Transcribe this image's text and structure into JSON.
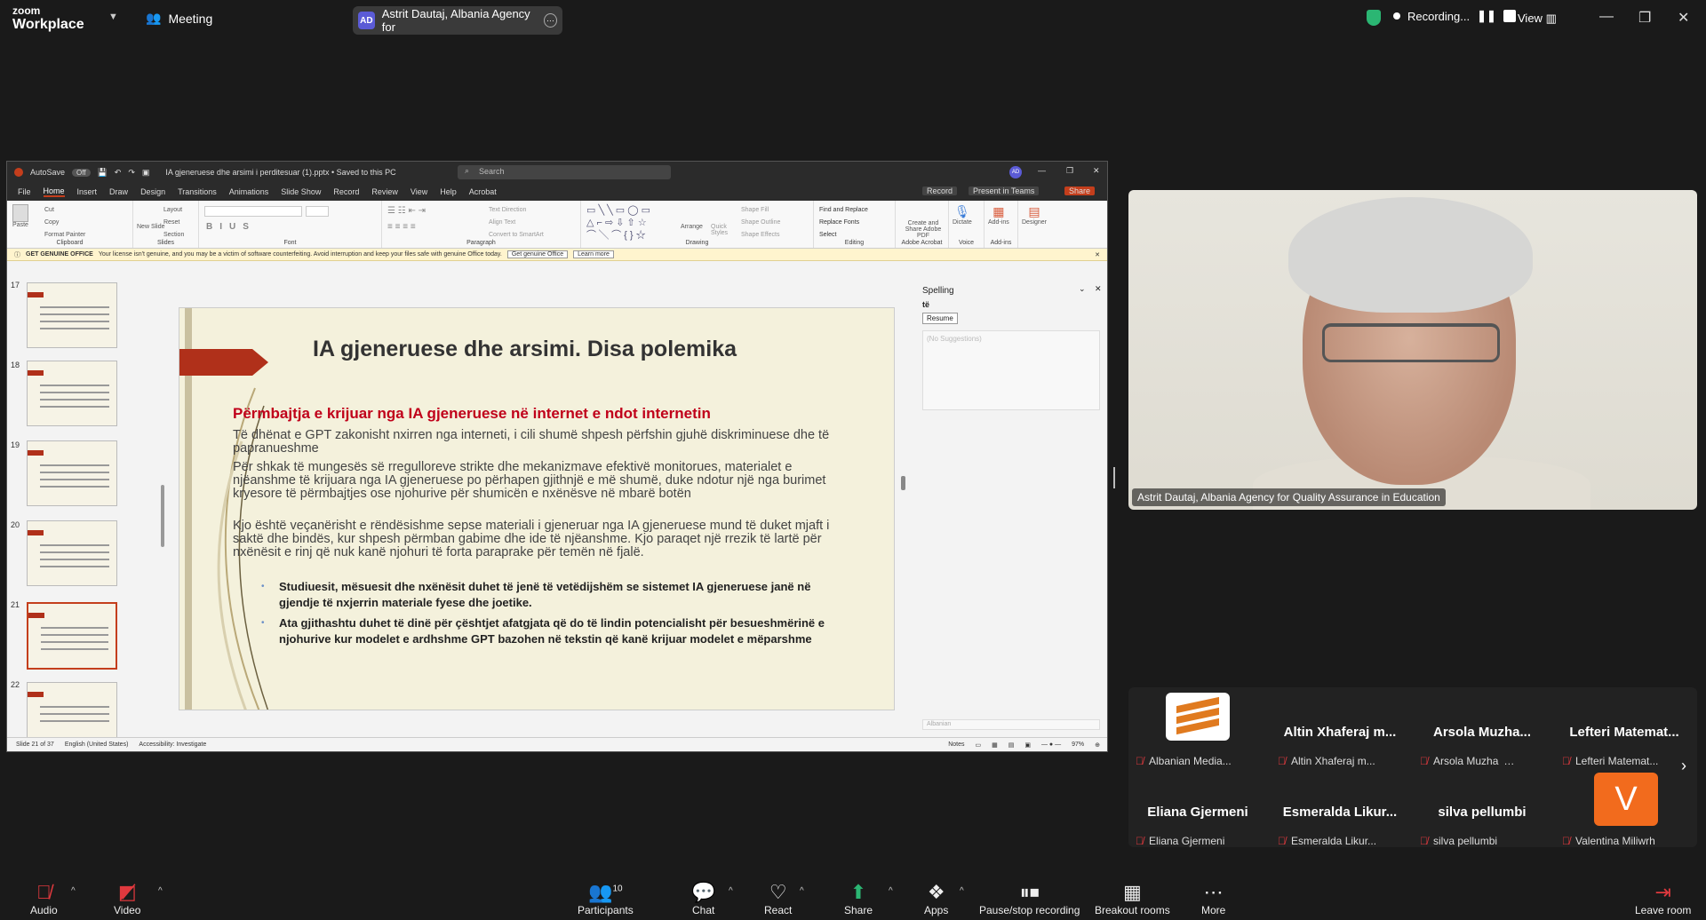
{
  "zoom": {
    "logo_top": "zoom",
    "logo_bottom": "Workplace",
    "meeting_label": "Meeting",
    "active_speaker": "Astrit Dautaj, Albania Agency for",
    "active_speaker_initials": "AD",
    "recording_label": "Recording...",
    "view_label": "View"
  },
  "ppt": {
    "autosave": "AutoSave",
    "autosave_state": "Off",
    "filename": "IA gjeneruese dhe arsimi i perditesuar (1).pptx • Saved to this PC",
    "search_placeholder": "Search",
    "user_initials": "AD",
    "menus": [
      "File",
      "Home",
      "Insert",
      "Draw",
      "Design",
      "Transitions",
      "Animations",
      "Slide Show",
      "Record",
      "Review",
      "View",
      "Help",
      "Acrobat"
    ],
    "record_btn": "Record",
    "present_teams": "Present in Teams",
    "share_btn": "Share",
    "ribbon": {
      "paste": "Paste",
      "cut": "Cut",
      "copy": "Copy",
      "format_painter": "Format Painter",
      "clipboard": "Clipboard",
      "new_slide": "New Slide",
      "layout": "Layout",
      "reset": "Reset",
      "section": "Section",
      "slides": "Slides",
      "font": "Font",
      "paragraph": "Paragraph",
      "text_direction": "Text Direction",
      "align_text": "Align Text",
      "convert_smartart": "Convert to SmartArt",
      "drawing": "Drawing",
      "arrange": "Arrange",
      "quick_styles": "Quick Styles",
      "shape_fill": "Shape Fill",
      "shape_outline": "Shape Outline",
      "shape_effects": "Shape Effects",
      "find_replace": "Find and Replace",
      "replace_fonts": "Replace Fonts",
      "select": "Select",
      "editing": "Editing",
      "create_share_pdf": "Create and Share Adobe PDF",
      "adobe_acrobat": "Adobe Acrobat",
      "dictate": "Dictate",
      "voice": "Voice",
      "addins": "Add-ins",
      "designer": "Designer"
    },
    "banner_title": "GET GENUINE OFFICE",
    "banner_text": "Your license isn't genuine, and you may be a victim of software counterfeiting. Avoid interruption and keep your files safe with genuine Office today.",
    "banner_btn1": "Get genuine Office",
    "banner_btn2": "Learn more",
    "thumb_numbers": [
      "17",
      "18",
      "19",
      "20",
      "21",
      "22"
    ],
    "slide": {
      "title": "IA gjeneruese dhe arsimi. Disa polemika",
      "heading": "Përmbajtja e krijuar nga IA gjeneruese në internet e ndot internetin",
      "p1": "Të dhënat e GPT zakonisht nxirren nga interneti, i cili shumë shpesh përfshin gjuhë diskriminuese dhe të papranueshme",
      "p2": "Për shkak të mungesës së rregulloreve strikte dhe mekanizmave efektivë monitorues, materialet e njëanshme të krijuara nga IA gjeneruese po përhapen gjithnjë e më shumë, duke ndotur një nga burimet kryesore të përmbajtjes ose njohurive për shumicën e nxënësve në mbarë botën",
      "p3": "Kjo është veçanërisht e rëndësishme sepse materiali i gjeneruar nga IA gjeneruese  mund të duket mjaft i saktë dhe bindës, kur shpesh përmban gabime dhe ide të njëanshme. Kjo paraqet një rrezik të lartë për nxënësit e rinj që nuk kanë njohuri të forta paraprake për temën në fjalë.",
      "b1": "Studiuesit, mësuesit dhe nxënësit duhet të jenë të vetëdijshëm se sistemet IA gjeneruese janë në gjendje të nxjerrin materiale fyese dhe joetike.",
      "b2": "Ata gjithashtu duhet të dinë për çështjet afatgjata që do të lindin potencialisht për besueshmërinë e njohurive kur modelet e ardhshme GPT bazohen në tekstin që kanë krijuar modelet e mëparshme"
    },
    "spelling": {
      "title": "Spelling",
      "word": "të",
      "resume": "Resume",
      "no_suggestions": "(No Suggestions)",
      "language": "Albanian"
    },
    "status": {
      "slide_count": "Slide 21 of 37",
      "language": "English (United States)",
      "accessibility": "Accessibility: Investigate",
      "notes": "Notes",
      "zoom": "97%"
    }
  },
  "video": {
    "name": "Astrit Dautaj, Albania Agency for Quality Assurance in Education"
  },
  "participants": [
    {
      "title": "",
      "name": "Albanian Media..."
    },
    {
      "title": "Altin Xhaferaj m...",
      "name": "Altin Xhaferaj m..."
    },
    {
      "title": "Arsola Muzha...",
      "name": "Arsola Muzha"
    },
    {
      "title": "Lefteri Matemat...",
      "name": "Lefteri Matemat..."
    },
    {
      "title": "Eliana Gjermeni",
      "name": "Eliana Gjermeni"
    },
    {
      "title": "Esmeralda Likur...",
      "name": "Esmeralda Likur..."
    },
    {
      "title": "silva pellumbi",
      "name": "silva pellumbi"
    },
    {
      "title": "V",
      "name": "Valentina Miliwrh"
    }
  ],
  "toolbar": {
    "audio": "Audio",
    "video": "Video",
    "participants": "Participants",
    "participants_count": "10",
    "chat": "Chat",
    "react": "React",
    "share": "Share",
    "apps": "Apps",
    "pause_rec": "Pause/stop recording",
    "breakout": "Breakout rooms",
    "more": "More",
    "leave": "Leave room"
  },
  "colors": {
    "zoom_bg": "#1a1a1a",
    "ppt_accent": "#c43e1c",
    "slide_red": "#c0001a",
    "share_green": "#2bb673",
    "leave_red": "#e0393e"
  }
}
